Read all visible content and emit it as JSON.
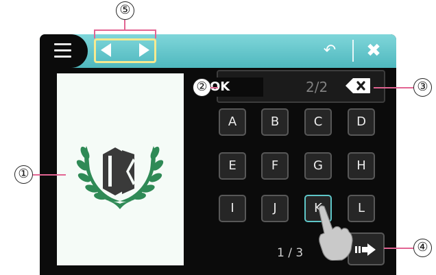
{
  "toolbar": {
    "menu_icon": "hamburger-icon",
    "prev_icon": "left-arrow-icon",
    "next_icon": "right-arrow-icon",
    "undo_icon": "undo-icon",
    "undo_glyph": "↶",
    "close_icon": "close-icon",
    "close_glyph": "✖"
  },
  "preview": {
    "monogram": "OK",
    "icon": "laurel-wreath-icon"
  },
  "input": {
    "value": "OK",
    "page_count": "2/2",
    "backspace_icon": "backspace-icon"
  },
  "keyboard": {
    "keys": [
      "A",
      "B",
      "C",
      "D",
      "E",
      "F",
      "G",
      "H",
      "I",
      "J",
      "K",
      "L"
    ],
    "active_key": "K",
    "page": "1 / 3",
    "next_icon": "next-page-icon"
  },
  "callouts": [
    "①",
    "②",
    "③",
    "④",
    "⑤"
  ],
  "colors": {
    "toolbar": "#4fb8be",
    "highlight_frame": "#f7ea8f",
    "callout_line": "#e26492",
    "active_key_border": "#5fc7c9",
    "monogram_fill": "#3a3a3a",
    "wreath_fill": "#2f8a56"
  }
}
